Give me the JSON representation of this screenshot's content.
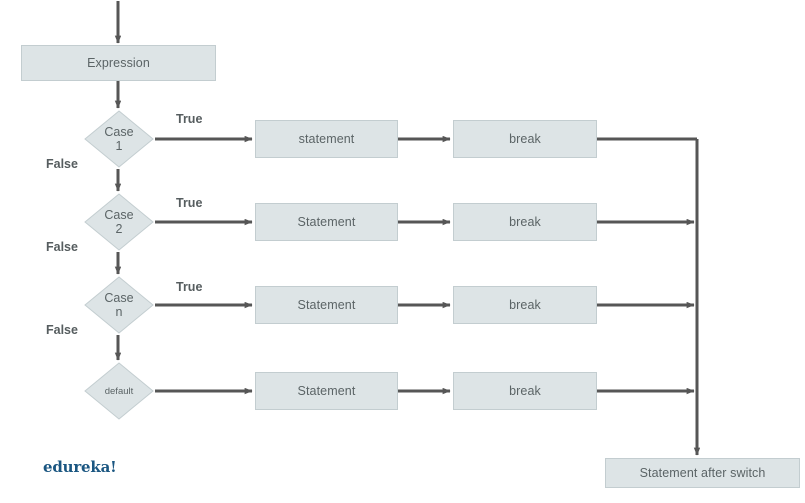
{
  "diagram": {
    "title": "switch statement flowchart",
    "colors": {
      "node_fill": "#dde4e6",
      "node_stroke": "#c3cdd0",
      "node_text": "#5b6466",
      "wire": "#565656",
      "label_text": "#565d5f",
      "brand": "#1a5681",
      "background": "#ffffff"
    },
    "nodes": {
      "expression": {
        "label": "Expression",
        "shape": "process"
      },
      "case1": {
        "label": "Case\n1",
        "shape": "decision"
      },
      "case2": {
        "label": "Case\n2",
        "shape": "decision"
      },
      "casen": {
        "label": "Case\nn",
        "shape": "decision"
      },
      "default": {
        "label": "default",
        "shape": "decision"
      },
      "statement1": {
        "label": "statement",
        "shape": "process"
      },
      "statement2": {
        "label": "Statement",
        "shape": "process"
      },
      "statement3": {
        "label": "Statement",
        "shape": "process"
      },
      "statement4": {
        "label": "Statement",
        "shape": "process"
      },
      "break1": {
        "label": "break",
        "shape": "process"
      },
      "break2": {
        "label": "break",
        "shape": "process"
      },
      "break3": {
        "label": "break",
        "shape": "process"
      },
      "break4": {
        "label": "break",
        "shape": "process"
      },
      "after": {
        "label": "Statement after switch",
        "shape": "process"
      }
    },
    "edge_labels": {
      "true1": "True",
      "true2": "True",
      "true3": "True",
      "false1": "False",
      "false2": "False",
      "false3": "False"
    },
    "brand": "edureka!"
  }
}
